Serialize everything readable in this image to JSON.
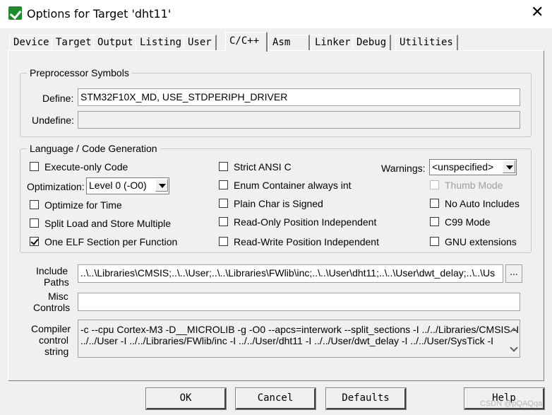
{
  "window": {
    "title": "Options for Target 'dht11'"
  },
  "tabs": [
    {
      "label": "Device"
    },
    {
      "label": "Target"
    },
    {
      "label": "Output"
    },
    {
      "label": "Listing"
    },
    {
      "label": "User"
    },
    {
      "label": "C/C++",
      "active": true
    },
    {
      "label": "Asm"
    },
    {
      "label": "Linker"
    },
    {
      "label": "Debug"
    },
    {
      "label": "Utilities"
    }
  ],
  "preprocessor": {
    "title": "Preprocessor Symbols",
    "define_label": "Define:",
    "define_value": "STM32F10X_MD, USE_STDPERIPH_DRIVER",
    "undefine_label": "Undefine:",
    "undefine_value": ""
  },
  "codegen": {
    "title": "Language / Code Generation",
    "execute_only": {
      "label": "Execute-only Code",
      "checked": false
    },
    "optimization_label": "Optimization:",
    "optimization_value": "Level 0 (-O0)",
    "optimize_time": {
      "label": "Optimize for Time",
      "checked": false
    },
    "split_load": {
      "label": "Split Load and Store Multiple",
      "checked": false
    },
    "one_elf": {
      "label": "One ELF Section per Function",
      "checked": true
    },
    "strict_ansi": {
      "label": "Strict ANSI C",
      "checked": false
    },
    "enum_container": {
      "label": "Enum Container always int",
      "checked": false
    },
    "plain_char": {
      "label": "Plain Char is Signed",
      "checked": false
    },
    "ro_pos": {
      "label": "Read-Only Position Independent",
      "checked": false
    },
    "rw_pos": {
      "label": "Read-Write Position Independent",
      "checked": false
    },
    "warnings_label": "Warnings:",
    "warnings_value": "<unspecified>",
    "thumb_mode": {
      "label": "Thumb Mode",
      "checked": false,
      "disabled": true
    },
    "no_auto_includes": {
      "label": "No Auto Includes",
      "checked": false
    },
    "c99_mode": {
      "label": "C99 Mode",
      "checked": false
    },
    "gnu_ext": {
      "label": "GNU extensions",
      "checked": false
    }
  },
  "include": {
    "label_line1": "Include",
    "label_line2": "Paths",
    "value": "..\\..\\Libraries\\CMSIS;..\\..\\User;..\\..\\Libraries\\FWlib\\inc;..\\..\\User\\dht11;..\\..\\User\\dwt_delay;..\\..\\Us",
    "browse_label": "..."
  },
  "misc": {
    "label_line1": "Misc",
    "label_line2": "Controls",
    "value": ""
  },
  "compiler": {
    "label_line1": "Compiler",
    "label_line2": "control",
    "label_line3": "string",
    "line1": "-c --cpu Cortex-M3 -D__MICROLIB -g -O0 --apcs=interwork --split_sections -I ../../Libraries/CMSIS -I",
    "line2": "../../User -I ../../Libraries/FWlib/inc -I ../../User/dht11 -I ../../User/dwt_delay -I ../../User/SysTick -I"
  },
  "buttons": {
    "ok": "OK",
    "cancel": "Cancel",
    "defaults": "Defaults",
    "help": "Help"
  },
  "watermark": "CSDN @pQAQqa"
}
